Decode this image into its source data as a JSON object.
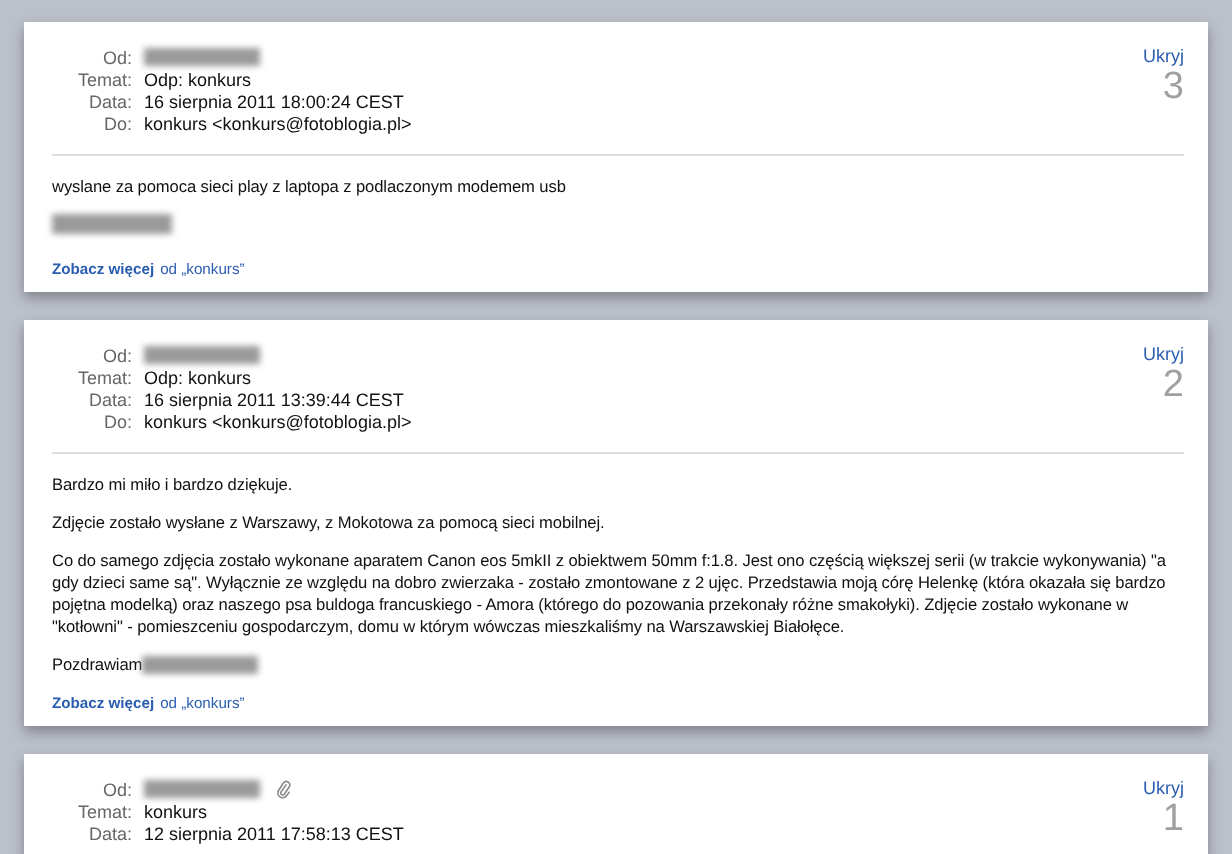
{
  "messages": [
    {
      "hide": "Ukryj",
      "number": "3",
      "attachment": false,
      "headers": [
        {
          "label": "Od:",
          "kind": "redacted"
        },
        {
          "label": "Temat:",
          "kind": "text",
          "value": "Odp: konkurs"
        },
        {
          "label": "Data:",
          "kind": "text",
          "value": "16 sierpnia 2011 18:00:24 CEST"
        },
        {
          "label": "Do:",
          "kind": "text",
          "value": "konkurs <konkurs@fotoblogia.pl>"
        }
      ],
      "body": [
        {
          "kind": "text",
          "text": "wyslane za pomoca sieci play z laptopa z podlaczonym modemem usb"
        },
        {
          "kind": "redacted"
        }
      ],
      "more_link": "Zobacz więcej",
      "more_rest": "od „konkurs”"
    },
    {
      "hide": "Ukryj",
      "number": "2",
      "attachment": false,
      "headers": [
        {
          "label": "Od:",
          "kind": "redacted"
        },
        {
          "label": "Temat:",
          "kind": "text",
          "value": "Odp: konkurs"
        },
        {
          "label": "Data:",
          "kind": "text",
          "value": "16 sierpnia 2011 13:39:44 CEST"
        },
        {
          "label": "Do:",
          "kind": "text",
          "value": "konkurs <konkurs@fotoblogia.pl>"
        }
      ],
      "body": [
        {
          "kind": "text",
          "text": "Bardzo mi miło i bardzo dziękuje."
        },
        {
          "kind": "text",
          "text": "Zdjęcie zostało wysłane z Warszawy, z Mokotowa za pomocą sieci mobilnej."
        },
        {
          "kind": "text",
          "text": "Co do samego zdjęcia zostało wykonane aparatem Canon eos 5mkII z obiektwem 50mm f:1.8. Jest ono częścią większej serii (w trakcie wykonywania) \"a gdy dzieci same są\". Wyłącznie ze względu na dobro zwierzaka - zostało zmontowane z 2 ujęc. Przedstawia moją córę Helenkę (która okazała się bardzo pojętna modelką) oraz naszego psa buldoga francuskiego - Amora (którego do pozowania przekonały różne smakołyki). Zdjęcie zostało wykonane w \"kotłowni\" - pomieszceniu gospodarczym, domu w którym wówczas mieszkaliśmy na Warszawskiej Białołęce."
        },
        {
          "kind": "text_redacted",
          "text": "Pozdrawiam"
        }
      ],
      "more_link": "Zobacz więcej",
      "more_rest": "od „konkurs”"
    },
    {
      "hide": "Ukryj",
      "number": "1",
      "attachment": true,
      "headers": [
        {
          "label": "Od:",
          "kind": "redacted"
        },
        {
          "label": "Temat:",
          "kind": "text",
          "value": "konkurs"
        },
        {
          "label": "Data:",
          "kind": "text",
          "value": "12 sierpnia 2011 17:58:13 CEST"
        }
      ]
    }
  ]
}
